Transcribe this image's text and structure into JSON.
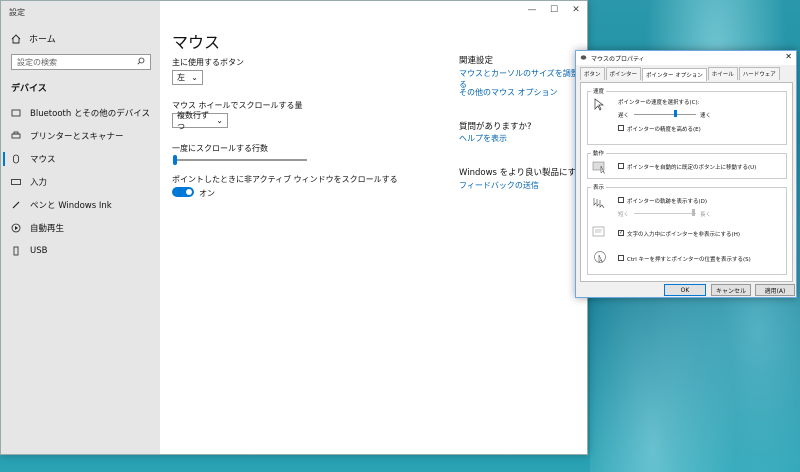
{
  "settings": {
    "app_title": "設定",
    "home": "ホーム",
    "search_placeholder": "設定の検索",
    "section": "デバイス",
    "nav": [
      {
        "label": "Bluetooth とその他のデバイス",
        "icon": "bluetooth-icon"
      },
      {
        "label": "プリンターとスキャナー",
        "icon": "printer-icon"
      },
      {
        "label": "マウス",
        "icon": "mouse-icon"
      },
      {
        "label": "入力",
        "icon": "keyboard-icon"
      },
      {
        "label": "ペンと Windows Ink",
        "icon": "pen-icon"
      },
      {
        "label": "自動再生",
        "icon": "autoplay-icon"
      },
      {
        "label": "USB",
        "icon": "usb-icon"
      }
    ],
    "page_title": "マウス",
    "primary_button_label": "主に使用するボタン",
    "primary_button_value": "左",
    "wheel_label": "マウス ホイールでスクロールする量",
    "wheel_value": "複数行ずつ",
    "lines_label": "一度にスクロールする行数",
    "inactive_scroll_label": "ポイントしたときに非アクティブ ウィンドウをスクロールする",
    "toggle_state": "オン",
    "related_title": "関連設定",
    "related_links": [
      "マウスとカーソルのサイズを調整する",
      "その他のマウス オプション"
    ],
    "help_title": "質問がありますか?",
    "help_link": "ヘルプを表示",
    "feedback_title": "Windows をより良い製品にする",
    "feedback_link": "フィードバックの送信"
  },
  "dialog": {
    "title": "マウスのプロパティ",
    "tabs": [
      "ボタン",
      "ポインター",
      "ポインター オプション",
      "ホイール",
      "ハードウェア"
    ],
    "active_tab": "ポインター オプション",
    "speed_group": "速度",
    "speed_label": "ポインターの速度を選択する(C):",
    "slow": "遅く",
    "fast": "速く",
    "precision_label": "ポインターの精度を高める(E)",
    "precision_checked": false,
    "snap_group": "動作",
    "snap_label": "ポインターを自動的に既定のボタン上に移動する(U)",
    "snap_checked": false,
    "visibility_group": "表示",
    "trails_label": "ポインターの軌跡を表示する(D)",
    "trails_checked": false,
    "short": "短く",
    "long": "長く",
    "hide_label": "文字の入力中にポインターを非表示にする(H)",
    "hide_checked": true,
    "ctrl_label": "Ctrl キーを押すとポインターの位置を表示する(S)",
    "ctrl_checked": false,
    "ok": "OK",
    "cancel": "キャンセル",
    "apply": "適用(A)"
  }
}
